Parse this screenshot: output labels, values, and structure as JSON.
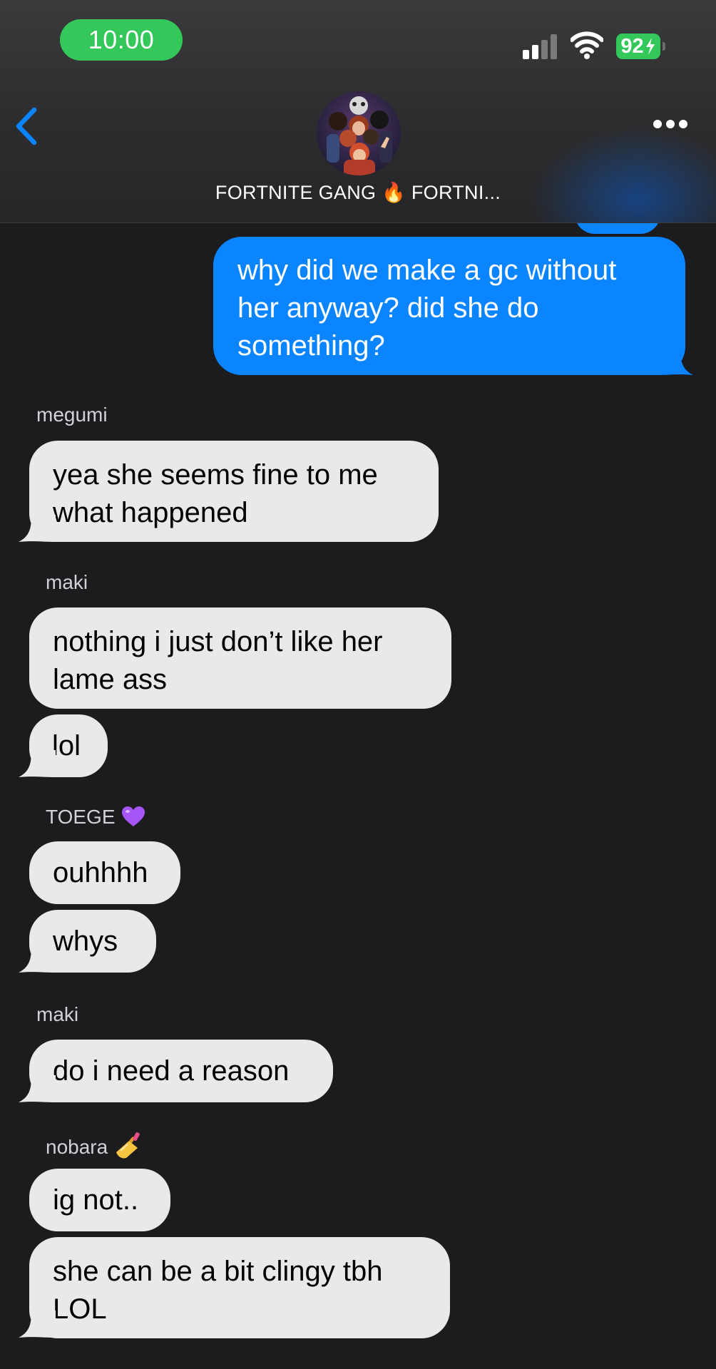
{
  "status_bar": {
    "time": "10:00",
    "battery": "92"
  },
  "header": {
    "title": "FORTNITE GANG 🔥 FORTNI..."
  },
  "messages": [
    {
      "type": "outgoing",
      "text": "why did we make a gc without her anyway? did she do something?"
    },
    {
      "type": "sender",
      "text": "megumi"
    },
    {
      "type": "incoming",
      "text": "yea she seems fine to me what happened"
    },
    {
      "type": "sender",
      "text": "maki"
    },
    {
      "type": "incoming",
      "text": "nothing i just don’t like her lame ass"
    },
    {
      "type": "incoming",
      "text": "lol"
    },
    {
      "type": "sender",
      "text": "TOEGE",
      "emoji": "purple-heart"
    },
    {
      "type": "incoming",
      "text": "ouhhhh"
    },
    {
      "type": "incoming",
      "text": "whys"
    },
    {
      "type": "sender",
      "text": "maki"
    },
    {
      "type": "incoming",
      "text": "do i need a reason"
    },
    {
      "type": "sender",
      "text": "nobara",
      "emoji": "nail-polish"
    },
    {
      "type": "incoming",
      "text": "ig not.."
    },
    {
      "type": "incoming",
      "text": "she can be a bit clingy tbh LOL"
    }
  ],
  "colors": {
    "background": "#1c1c1e",
    "incoming_bubble": "#e9e9eb",
    "outgoing_bubble": "#0a84ff",
    "status_green": "#34c759",
    "accent_blue": "#0a84ff"
  }
}
